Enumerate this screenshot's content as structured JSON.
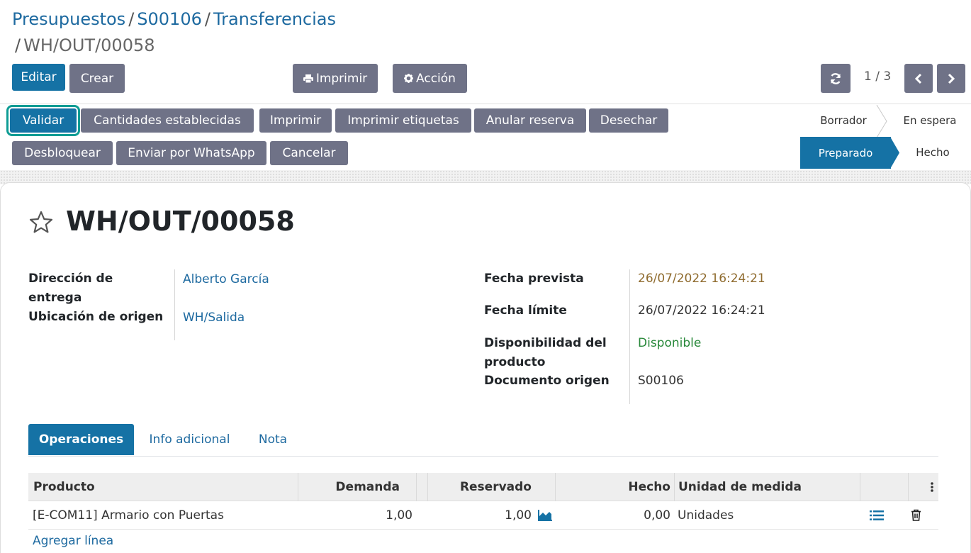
{
  "breadcrumb": {
    "items": [
      "Presupuestos",
      "S00106",
      "Transferencias"
    ],
    "current": "WH/OUT/00058",
    "separator": "/"
  },
  "toolbar": {
    "edit_label": "Editar",
    "create_label": "Crear",
    "print_label": "Imprimir",
    "action_label": "Acción",
    "pager": "1 / 3"
  },
  "status_buttons": {
    "validate": "Validar",
    "set_quantities": "Cantidades establecidas",
    "print": "Imprimir",
    "print_labels": "Imprimir etiquetas",
    "unreserve": "Anular reserva",
    "scrap": "Desechar",
    "unlock": "Desbloquear",
    "whatsapp": "Enviar por WhatsApp",
    "cancel": "Cancelar"
  },
  "stages": {
    "draft": "Borrador",
    "waiting": "En espera",
    "ready": "Preparado",
    "done": "Hecho",
    "active": "Preparado"
  },
  "record": {
    "title": "WH/OUT/00058",
    "delivery_address_label_1": "Dirección de",
    "delivery_address_label_2": "entrega",
    "delivery_address": "Alberto García",
    "source_location_label": "Ubicación de origen",
    "source_location": "WH/Salida",
    "scheduled_date_label": "Fecha prevista",
    "scheduled_date": "26/07/2022 16:24:21",
    "deadline_label": "Fecha límite",
    "deadline": "26/07/2022 16:24:21",
    "availability_label_1": "Disponibilidad del",
    "availability_label_2": "producto",
    "availability": "Disponible",
    "origin_label": "Documento origen",
    "origin": "S00106"
  },
  "tabs": [
    "Operaciones",
    "Info adicional",
    "Nota"
  ],
  "table": {
    "headers": [
      "Producto",
      "Demanda",
      "Reservado",
      "Hecho",
      "Unidad de medida"
    ],
    "rows": [
      {
        "product": "[E-COM11] Armario con Puertas",
        "demand": "1,00",
        "reserved": "1,00",
        "done": "0,00",
        "uom": "Unidades"
      }
    ],
    "add_line": "Agregar línea"
  },
  "colors": {
    "primary": "#1572a5",
    "secondary": "#6f7287",
    "link": "#1e6aa0",
    "date_warning": "#8f6b2e",
    "available": "#28883a",
    "highlight": "#0e9c94"
  }
}
